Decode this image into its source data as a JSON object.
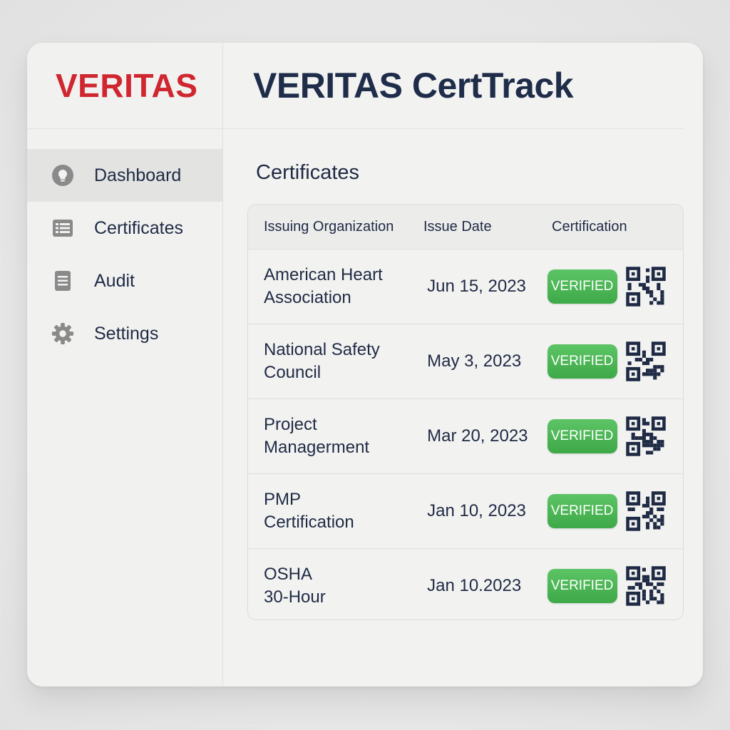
{
  "sidebar": {
    "brand": "VERITAS",
    "items": [
      {
        "label": "Dashboard",
        "icon": "lightbulb-icon",
        "active": true
      },
      {
        "label": "Certificates",
        "icon": "list-icon",
        "active": false
      },
      {
        "label": "Audit",
        "icon": "document-icon",
        "active": false
      },
      {
        "label": "Settings",
        "icon": "gear-icon",
        "active": false
      }
    ]
  },
  "header": {
    "title": "VERITAS CertTrack"
  },
  "main": {
    "section_title": "Certificates",
    "table": {
      "columns": [
        "Issuing Organization",
        "Issue Date",
        "Certification"
      ],
      "rows": [
        {
          "org": "American Heart\nAssociation",
          "date": "Jun 15, 2023",
          "status": "VERIFIED"
        },
        {
          "org": "National Safety\nCouncil",
          "date": "May 3, 2023",
          "status": "VERIFIED"
        },
        {
          "org": "Project\nManagerment",
          "date": "Mar 20, 2023",
          "status": "VERIFIED"
        },
        {
          "org": "PMP\nCertification",
          "date": "Jan 10, 2023",
          "status": "VERIFIED"
        },
        {
          "org": "OSHA\n30-Hour",
          "date": "Jan 10.2023",
          "status": "VERIFIED"
        }
      ]
    }
  },
  "colors": {
    "brand_red": "#d0262f",
    "title_navy": "#1f2d4a",
    "verified_green": "#4cb756"
  }
}
